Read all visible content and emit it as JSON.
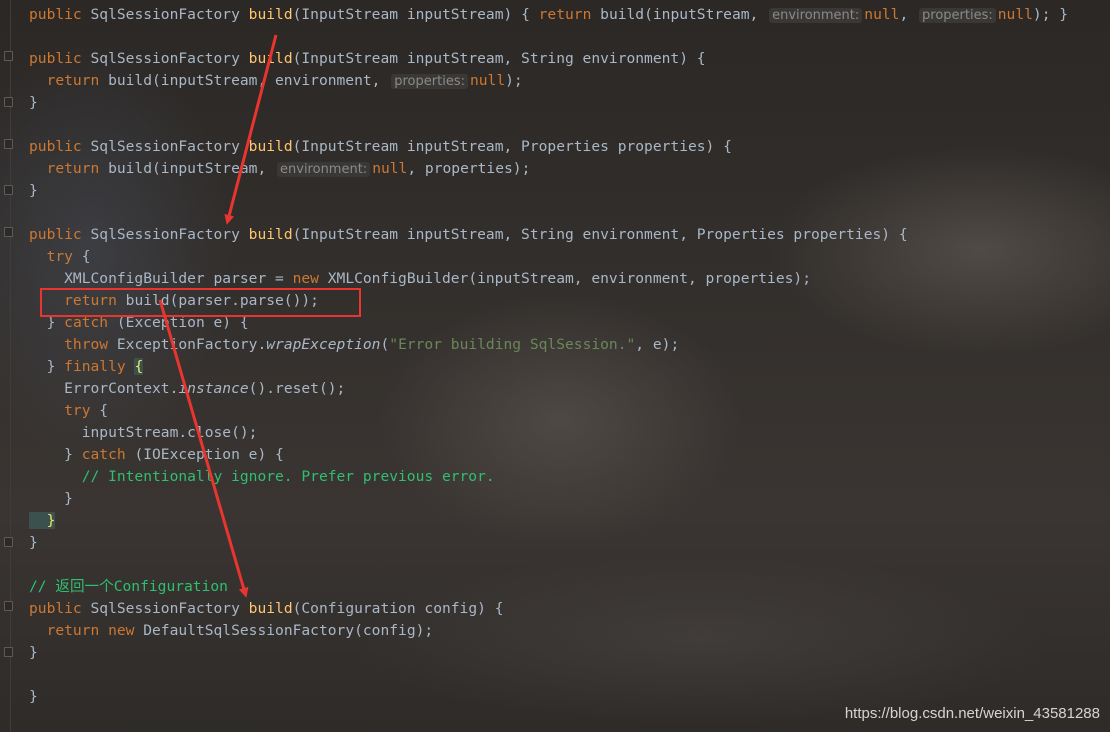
{
  "editor": {
    "language": "Java",
    "theme": "dark",
    "lines": [
      {
        "tokens": [
          {
            "t": "public ",
            "c": "kw"
          },
          {
            "t": "SqlSessionFactory ",
            "c": "plain"
          },
          {
            "t": "build",
            "c": "fn"
          },
          {
            "t": "(InputStream inputStream) ",
            "c": "plain"
          },
          {
            "t": "{ ",
            "c": "plain"
          },
          {
            "t": "return ",
            "c": "kw"
          },
          {
            "t": "build(inputStream, ",
            "c": "plain"
          },
          {
            "t": "environment:",
            "c": "hint"
          },
          {
            "t": "null",
            "c": "kw"
          },
          {
            "t": ", ",
            "c": "plain"
          },
          {
            "t": "properties:",
            "c": "hint"
          },
          {
            "t": "null",
            "c": "kw"
          },
          {
            "t": "); }",
            "c": "plain"
          }
        ]
      },
      {
        "tokens": []
      },
      {
        "tokens": [
          {
            "t": "public ",
            "c": "kw"
          },
          {
            "t": "SqlSessionFactory ",
            "c": "plain"
          },
          {
            "t": "build",
            "c": "fn"
          },
          {
            "t": "(InputStream inputStream, String environment) {",
            "c": "plain"
          }
        ]
      },
      {
        "tokens": [
          {
            "t": "  return ",
            "c": "kw"
          },
          {
            "t": "build(inputStream, environment, ",
            "c": "plain"
          },
          {
            "t": "properties:",
            "c": "hint"
          },
          {
            "t": "null",
            "c": "kw"
          },
          {
            "t": ");",
            "c": "plain"
          }
        ]
      },
      {
        "tokens": [
          {
            "t": "}",
            "c": "plain"
          }
        ]
      },
      {
        "tokens": []
      },
      {
        "tokens": [
          {
            "t": "public ",
            "c": "kw"
          },
          {
            "t": "SqlSessionFactory ",
            "c": "plain"
          },
          {
            "t": "build",
            "c": "fn"
          },
          {
            "t": "(InputStream inputStream, Properties properties) {",
            "c": "plain"
          }
        ]
      },
      {
        "tokens": [
          {
            "t": "  return ",
            "c": "kw"
          },
          {
            "t": "build(inputStream, ",
            "c": "plain"
          },
          {
            "t": "environment:",
            "c": "hint"
          },
          {
            "t": "null",
            "c": "kw"
          },
          {
            "t": ", properties);",
            "c": "plain"
          }
        ]
      },
      {
        "tokens": [
          {
            "t": "}",
            "c": "plain"
          }
        ]
      },
      {
        "tokens": []
      },
      {
        "tokens": [
          {
            "t": "public ",
            "c": "kw"
          },
          {
            "t": "SqlSessionFactory ",
            "c": "plain"
          },
          {
            "t": "build",
            "c": "fn"
          },
          {
            "t": "(InputStream inputStream, String environment, Properties properties) {",
            "c": "plain"
          }
        ]
      },
      {
        "tokens": [
          {
            "t": "  try ",
            "c": "kw"
          },
          {
            "t": "{",
            "c": "plain"
          }
        ]
      },
      {
        "tokens": [
          {
            "t": "    XMLConfigBuilder parser = ",
            "c": "plain"
          },
          {
            "t": "new ",
            "c": "kw"
          },
          {
            "t": "XMLConfigBuilder(inputStream, environment, properties);",
            "c": "plain"
          }
        ]
      },
      {
        "tokens": [
          {
            "t": "    return ",
            "c": "kw"
          },
          {
            "t": "build(parser.parse());",
            "c": "plain"
          }
        ]
      },
      {
        "tokens": [
          {
            "t": "  } ",
            "c": "plain"
          },
          {
            "t": "catch ",
            "c": "kw"
          },
          {
            "t": "(Exception e) {",
            "c": "plain"
          }
        ]
      },
      {
        "tokens": [
          {
            "t": "    throw ",
            "c": "kw"
          },
          {
            "t": "ExceptionFactory.",
            "c": "plain"
          },
          {
            "t": "wrapException",
            "c": "it"
          },
          {
            "t": "(",
            "c": "plain"
          },
          {
            "t": "\"Error building SqlSession.\"",
            "c": "str"
          },
          {
            "t": ", e);",
            "c": "plain"
          }
        ]
      },
      {
        "tokens": [
          {
            "t": "  } ",
            "c": "plain"
          },
          {
            "t": "finally ",
            "c": "kw"
          },
          {
            "t": "{",
            "c": "hl"
          }
        ]
      },
      {
        "tokens": [
          {
            "t": "    ErrorContext.",
            "c": "plain"
          },
          {
            "t": "instance",
            "c": "it"
          },
          {
            "t": "().reset();",
            "c": "plain"
          }
        ]
      },
      {
        "tokens": [
          {
            "t": "    try ",
            "c": "kw"
          },
          {
            "t": "{",
            "c": "plain"
          }
        ]
      },
      {
        "tokens": [
          {
            "t": "      inputStream.close();",
            "c": "plain"
          }
        ]
      },
      {
        "tokens": [
          {
            "t": "    } ",
            "c": "plain"
          },
          {
            "t": "catch ",
            "c": "kw"
          },
          {
            "t": "(IOException e) {",
            "c": "plain"
          }
        ]
      },
      {
        "tokens": [
          {
            "t": "      // Intentionally ignore. Prefer previous error.",
            "c": "cm"
          }
        ]
      },
      {
        "tokens": [
          {
            "t": "    }",
            "c": "plain"
          }
        ]
      },
      {
        "tokens": [
          {
            "t": "  }",
            "c": "hl"
          }
        ]
      },
      {
        "tokens": [
          {
            "t": "}",
            "c": "plain"
          }
        ]
      },
      {
        "tokens": []
      },
      {
        "tokens": [
          {
            "t": "// 返回一个Configuration",
            "c": "cm"
          }
        ]
      },
      {
        "tokens": [
          {
            "t": "public ",
            "c": "kw"
          },
          {
            "t": "SqlSessionFactory ",
            "c": "plain"
          },
          {
            "t": "build",
            "c": "fn"
          },
          {
            "t": "(Configuration config) {",
            "c": "plain"
          }
        ]
      },
      {
        "tokens": [
          {
            "t": "  return ",
            "c": "kw"
          },
          {
            "t": "new ",
            "c": "kw"
          },
          {
            "t": "DefaultSqlSessionFactory(config);",
            "c": "plain"
          }
        ]
      },
      {
        "tokens": [
          {
            "t": "}",
            "c": "plain"
          }
        ]
      },
      {
        "tokens": []
      },
      {
        "tokens": [
          {
            "t": "}",
            "c": "plain"
          }
        ]
      }
    ]
  },
  "annotations": {
    "highlight_color": "#e8352f",
    "arrow_color": "#e8352f"
  },
  "watermark": {
    "text": "https://blog.csdn.net/weixin_43581288"
  },
  "colors": {
    "keyword": "#cc7832",
    "method": "#ffc66d",
    "string": "#6a8759",
    "comment": "#2fbf71",
    "text": "#a9b7c6",
    "hint": "#8a8a8a"
  }
}
